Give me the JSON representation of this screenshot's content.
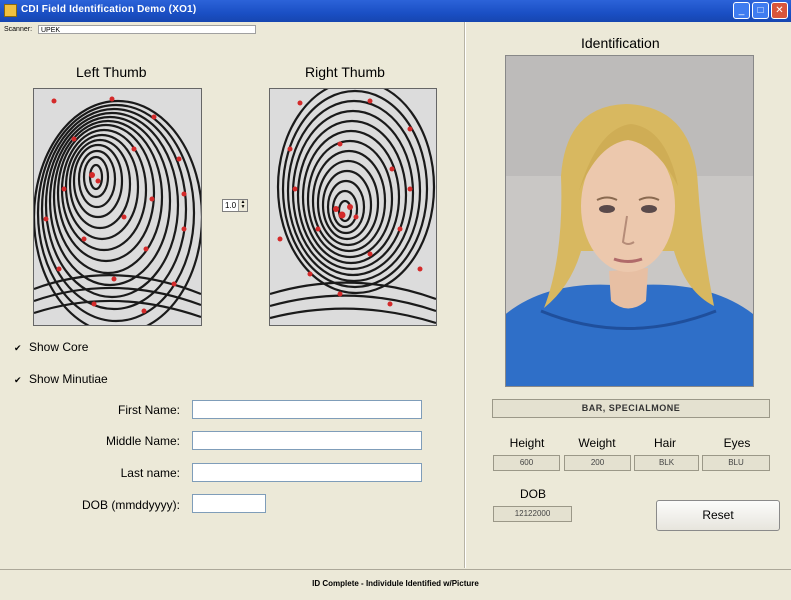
{
  "window": {
    "title": "CDI Field Identification Demo (XO1)",
    "buttons": [
      "_",
      "□",
      "✕"
    ]
  },
  "scanner": {
    "label": "Scanner:",
    "value": "UPEK"
  },
  "left_panel": {
    "left_thumb_label": "Left Thumb",
    "right_thumb_label": "Right Thumb",
    "threshold_value": "1.0",
    "show_core": {
      "label": "Show Core",
      "checked": true
    },
    "show_minutiae": {
      "label": "Show Minutiae",
      "checked": true
    },
    "form": {
      "first_name": {
        "label": "First Name:",
        "value": ""
      },
      "middle_name": {
        "label": "Middle Name:",
        "value": ""
      },
      "last_name": {
        "label": "Last name:",
        "value": ""
      },
      "dob": {
        "label": "DOB (mmddyyyy):",
        "value": ""
      }
    }
  },
  "right_panel": {
    "heading": "Identification",
    "name_value": "BAR, SPECIALMONE",
    "headers": {
      "height": "Height",
      "weight": "Weight",
      "hair": "Hair",
      "eyes": "Eyes"
    },
    "values": {
      "height": "600",
      "weight": "200",
      "hair": "BLK",
      "eyes": "BLU"
    },
    "dob_label": "DOB",
    "dob_value": "12122000",
    "reset_label": "Reset"
  },
  "status": {
    "text": "ID Complete - Individule Identified w/Picture"
  },
  "colors": {
    "titlebar": "#1a4fc4",
    "minutiae": "#d42a2a",
    "hoodie": "#2f6fc8",
    "hair": "#d8b860"
  }
}
